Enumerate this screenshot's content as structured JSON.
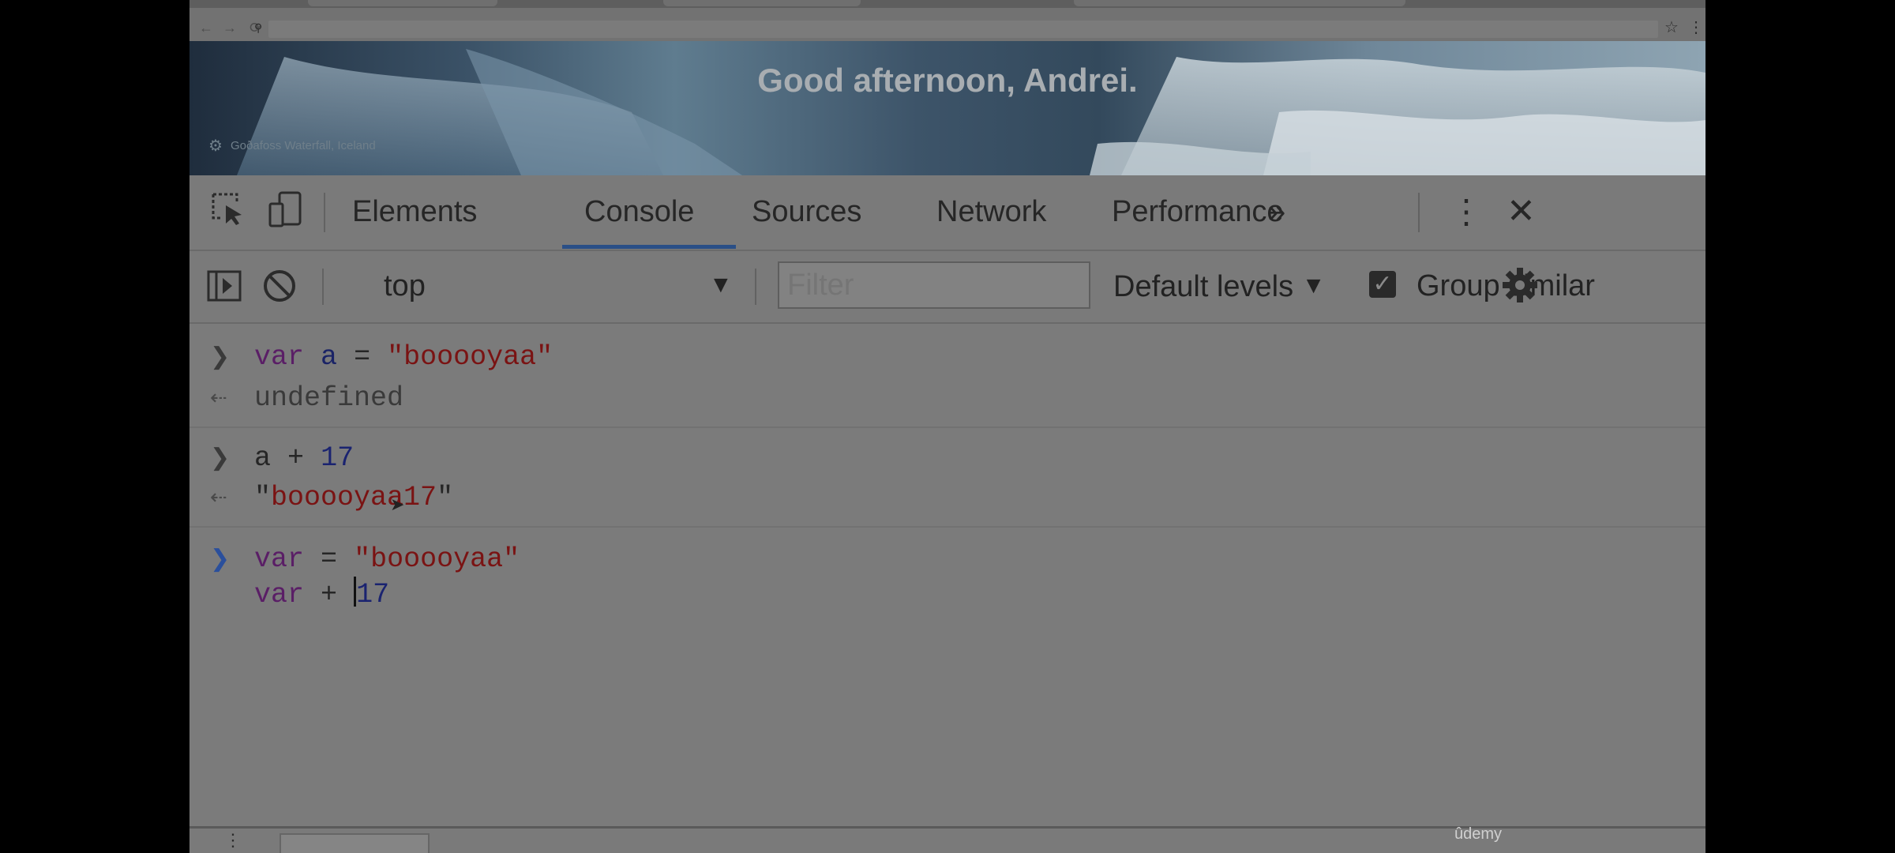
{
  "banner": {
    "greeting": "Good afternoon, Andrei.",
    "photo_credit": "Goðafoss Waterfall, Iceland"
  },
  "devtools": {
    "tabs": [
      "Elements",
      "Console",
      "Sources",
      "Network",
      "Performance"
    ],
    "active_tab": "Console",
    "more_tabs_icon": "double-chevron-right-icon",
    "toolbar": {
      "context": "top",
      "filter_placeholder": "Filter",
      "levels": "Default levels",
      "group_similar_label": "Group similar",
      "group_similar_checked": true
    }
  },
  "console": {
    "entries": [
      {
        "type": "input",
        "text": "var a = \"booooyaa\""
      },
      {
        "type": "output",
        "text": "undefined"
      },
      {
        "type": "input",
        "text": "a + 17"
      },
      {
        "type": "output",
        "text": "\"booooyaa17\""
      }
    ],
    "current_input": [
      "var = \"booooyaa\"",
      "var + 17"
    ]
  },
  "watermark": "ûdemy",
  "colors": {
    "keyword": "#5a1e66",
    "string": "#7a1313",
    "number": "#1a2370",
    "active_tab_underline": "#2a4f87"
  }
}
